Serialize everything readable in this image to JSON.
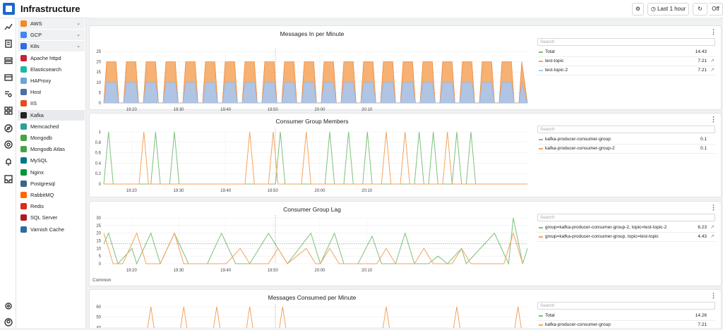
{
  "app": {
    "title": "Infrastructure"
  },
  "toolbar": {
    "time_range": "Last 1 hour",
    "refresh_state": "Off"
  },
  "sidebar": {
    "items": [
      {
        "label": "AWS",
        "icon": "aws-icon",
        "color": "#f08a24",
        "expandable": true
      },
      {
        "label": "GCP",
        "icon": "gcp-icon",
        "color": "#4285f4",
        "expandable": true
      },
      {
        "label": "K8s",
        "icon": "k8s-icon",
        "color": "#326ce5",
        "expandable": true
      },
      {
        "label": "Apache httpd",
        "icon": "apache-icon",
        "color": "#c92037"
      },
      {
        "label": "Elasticsearch",
        "icon": "elasticsearch-icon",
        "color": "#1bb9a7"
      },
      {
        "label": "HAProxy",
        "icon": "haproxy-icon",
        "color": "#6aa5d8"
      },
      {
        "label": "Host",
        "icon": "host-icon",
        "color": "#4a6fa5"
      },
      {
        "label": "IIS",
        "icon": "iis-icon",
        "color": "#e74c1c"
      },
      {
        "label": "Kafka",
        "icon": "kafka-icon",
        "color": "#222222",
        "active": true
      },
      {
        "label": "Memcached",
        "icon": "memcached-icon",
        "color": "#2aa198"
      },
      {
        "label": "Mongodb",
        "icon": "mongodb-icon",
        "color": "#47a248"
      },
      {
        "label": "Mongodb Atlas",
        "icon": "mongodb-atlas-icon",
        "color": "#47a248"
      },
      {
        "label": "MySQL",
        "icon": "mysql-icon",
        "color": "#00758f"
      },
      {
        "label": "Nginx",
        "icon": "nginx-icon",
        "color": "#009639"
      },
      {
        "label": "Postgresql",
        "icon": "postgresql-icon",
        "color": "#336791"
      },
      {
        "label": "RabbitMQ",
        "icon": "rabbitmq-icon",
        "color": "#ff6600"
      },
      {
        "label": "Redis",
        "icon": "redis-icon",
        "color": "#d82c20"
      },
      {
        "label": "SQL Server",
        "icon": "sql-server-icon",
        "color": "#a91d22"
      },
      {
        "label": "Varnish Cache",
        "icon": "varnish-icon",
        "color": "#2d6ca2"
      }
    ]
  },
  "rail": {
    "icons": [
      "metrics-icon",
      "logs-icon",
      "infrastructure-icon",
      "servers-icon",
      "search-logs-icon",
      "dashboards-icon",
      "explore-icon",
      "services-icon",
      "alerts-icon",
      "inbox-icon",
      "settings-icon",
      "account-icon"
    ]
  },
  "colors": {
    "green": "#7ec07a",
    "orange": "#f5a35a",
    "blue": "#a9c6f1",
    "accent": "#1c67c9"
  },
  "panels": [
    {
      "title": "Messages In per Minute",
      "search_placeholder": "Search",
      "legend": [
        {
          "name": "Total",
          "value": "14.43",
          "color": "#7ec07a",
          "link": false
        },
        {
          "name": "test-topic",
          "value": "7.21",
          "color": "#f5a35a",
          "link": true
        },
        {
          "name": "test-topic-2",
          "value": "7.21",
          "color": "#a9c6f1",
          "link": true
        }
      ]
    },
    {
      "title": "Consumer Group Members",
      "search_placeholder": "Search",
      "legend": [
        {
          "name": "kafka-producer-consumer-group",
          "value": "0.1",
          "color": "#7ec07a",
          "link": false
        },
        {
          "name": "kafka-producer-consumer-group-2",
          "value": "0.1",
          "color": "#f5a35a",
          "link": false
        }
      ]
    },
    {
      "title": "Consumer Group Lag",
      "search_placeholder": "Search",
      "footer": "Common",
      "legend": [
        {
          "name": "group=kafka-producer-consumer-group-2, topic=test-topic-2",
          "value": "6.23",
          "color": "#7ec07a",
          "link": true
        },
        {
          "name": "group=kafka-producer-consumer-group, topic=test-topic",
          "value": "4.43",
          "color": "#f5a35a",
          "link": true
        }
      ]
    },
    {
      "title": "Messages Consumed per Minute",
      "search_placeholder": "Search",
      "legend": [
        {
          "name": "Total",
          "value": "14.26",
          "color": "#7ec07a",
          "link": false
        },
        {
          "name": "kafka-producer-consumer-group",
          "value": "7.21",
          "color": "#f5a35a",
          "link": false
        }
      ]
    }
  ],
  "chart_data": [
    {
      "type": "area",
      "title": "Messages In per Minute",
      "x_ticks": [
        "19:20",
        "19:30",
        "19:40",
        "19:50",
        "20:00",
        "20:10"
      ],
      "y_ticks": [
        0,
        5,
        10,
        15,
        20,
        25
      ],
      "ylim": [
        0,
        25
      ],
      "stacked": true,
      "series": [
        {
          "name": "test-topic-2",
          "color": "#a9c6f1",
          "pattern_peak": 10
        },
        {
          "name": "test-topic",
          "color": "#f5a35a",
          "pattern_peak": 10
        }
      ]
    },
    {
      "type": "line",
      "title": "Consumer Group Members",
      "x_ticks": [
        "19:20",
        "19:30",
        "19:40",
        "19:50",
        "20:00",
        "20:10"
      ],
      "y_ticks": [
        0,
        0.2,
        0.4,
        0.6,
        0.8,
        1
      ],
      "ylim": [
        0,
        1
      ],
      "series": [
        {
          "name": "kafka-producer-consumer-group",
          "color": "#7ec07a",
          "spikes_minutes": [
            1,
            11,
            15,
            37.5,
            48,
            52,
            56,
            67,
            70,
            75,
            78
          ]
        },
        {
          "name": "kafka-producer-consumer-group-2",
          "color": "#f5a35a",
          "spikes_minutes": [
            8.5,
            31,
            36,
            43,
            60,
            64,
            73
          ]
        }
      ]
    },
    {
      "type": "line",
      "title": "Consumer Group Lag",
      "x_ticks": [
        "19:20",
        "19:30",
        "19:40",
        "19:50",
        "20:00",
        "20:10"
      ],
      "y_ticks": [
        0,
        5,
        10,
        15,
        20,
        25,
        30
      ],
      "ylim": [
        0,
        30
      ],
      "series": [
        {
          "name": "group=kafka-producer-consumer-group-2, topic=test-topic-2",
          "color": "#7ec07a",
          "points": [
            [
              0,
              13
            ],
            [
              1,
              20
            ],
            [
              3,
              0
            ],
            [
              6,
              10
            ],
            [
              7,
              0
            ],
            [
              10,
              20
            ],
            [
              12,
              0
            ],
            [
              15,
              20
            ],
            [
              18,
              0
            ],
            [
              22,
              0
            ],
            [
              25,
              20
            ],
            [
              28,
              0
            ],
            [
              31,
              0
            ],
            [
              35,
              20
            ],
            [
              37,
              10
            ],
            [
              39,
              0
            ],
            [
              44,
              20
            ],
            [
              46,
              0
            ],
            [
              49,
              20
            ],
            [
              51,
              0
            ],
            [
              54,
              0
            ],
            [
              57,
              18
            ],
            [
              59,
              0
            ],
            [
              62,
              0
            ],
            [
              64,
              20
            ],
            [
              66,
              0
            ],
            [
              69,
              0
            ],
            [
              71,
              5
            ],
            [
              73,
              0
            ],
            [
              76,
              10
            ],
            [
              77,
              0
            ],
            [
              83,
              20
            ],
            [
              86,
              0
            ],
            [
              87,
              30
            ],
            [
              89,
              0
            ],
            [
              90,
              10
            ]
          ]
        },
        {
          "name": "group=kafka-producer-consumer-group, topic=test-topic",
          "color": "#f5a35a",
          "points": [
            [
              0,
              20
            ],
            [
              2,
              0
            ],
            [
              4,
              0
            ],
            [
              7,
              20
            ],
            [
              9,
              0
            ],
            [
              12,
              0
            ],
            [
              15,
              20
            ],
            [
              17,
              0
            ],
            [
              26,
              0
            ],
            [
              29,
              10
            ],
            [
              31,
              0
            ],
            [
              35,
              0
            ],
            [
              37,
              10
            ],
            [
              39,
              0
            ],
            [
              43,
              10
            ],
            [
              45,
              0
            ],
            [
              46,
              0
            ],
            [
              48,
              10
            ],
            [
              50,
              0
            ],
            [
              58,
              0
            ],
            [
              60,
              10
            ],
            [
              62,
              0
            ],
            [
              66,
              0
            ],
            [
              68,
              10
            ],
            [
              70,
              0
            ],
            [
              74,
              0
            ],
            [
              76,
              10
            ],
            [
              78,
              0
            ],
            [
              85,
              0
            ],
            [
              87,
              20
            ],
            [
              89,
              0
            ]
          ]
        }
      ]
    },
    {
      "type": "line",
      "title": "Messages Consumed per Minute",
      "y_ticks": [
        40,
        50,
        60
      ],
      "ylim": [
        30,
        60
      ],
      "series": [
        {
          "name": "kafka-producer-consumer-group",
          "color": "#f5a35a",
          "spikes_minutes": [
            10,
            17,
            24,
            31,
            38,
            60,
            75,
            88
          ]
        }
      ]
    }
  ]
}
